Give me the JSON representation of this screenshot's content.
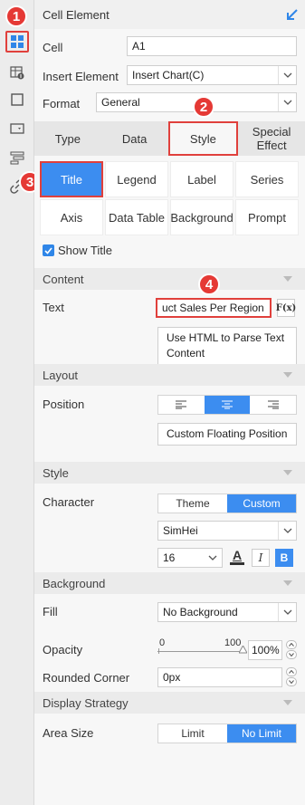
{
  "header": {
    "title": "Cell Element"
  },
  "sidebar": {
    "items": [
      {
        "name": "cell-element",
        "active": true
      },
      {
        "name": "cell-attributes",
        "active": false
      },
      {
        "name": "border-style",
        "active": false
      },
      {
        "name": "widget",
        "active": false
      },
      {
        "name": "condition",
        "active": false
      },
      {
        "name": "hyperlink",
        "active": false
      }
    ]
  },
  "cell": {
    "label": "Cell",
    "value": "A1"
  },
  "insert": {
    "label": "Insert Element",
    "value": "Insert Chart(C)"
  },
  "format": {
    "label": "Format",
    "value": "General"
  },
  "tabs": [
    {
      "label": "Type"
    },
    {
      "label": "Data"
    },
    {
      "label": "Style"
    },
    {
      "label": "Special Effect"
    }
  ],
  "subtabs": [
    {
      "label": "Title"
    },
    {
      "label": "Legend"
    },
    {
      "label": "Label"
    },
    {
      "label": "Series"
    },
    {
      "label": "Axis"
    },
    {
      "label": "Data Table"
    },
    {
      "label": "Background"
    },
    {
      "label": "Prompt"
    }
  ],
  "show_title": {
    "label": "Show Title",
    "checked": true
  },
  "content": {
    "section": "Content",
    "text_label": "Text",
    "text_value": "uct Sales Per Region",
    "fx_label": "F(x)",
    "html_option": "Use HTML to Parse Text Content"
  },
  "layout": {
    "section": "Layout",
    "position_label": "Position",
    "custom_floating": "Custom Floating Position"
  },
  "style": {
    "section": "Style",
    "character_label": "Character",
    "theme_label": "Theme",
    "custom_label": "Custom",
    "font": "SimHei",
    "size": "16",
    "bold": "B",
    "italic": "I",
    "font_color_glyph": "A"
  },
  "background": {
    "section": "Background",
    "fill_label": "Fill",
    "fill_value": "No Background",
    "opacity_label": "Opacity",
    "opacity_min": "0",
    "opacity_max": "100",
    "opacity_value": "100%",
    "corner_label": "Rounded Corner",
    "corner_value": "0px"
  },
  "display": {
    "section": "Display Strategy",
    "area_label": "Area Size",
    "limit": "Limit",
    "no_limit": "No Limit"
  },
  "badges": [
    "1",
    "2",
    "3",
    "4"
  ],
  "colors": {
    "accent": "#3c8df0",
    "highlight": "#e0403c",
    "badge": "#e53935"
  }
}
